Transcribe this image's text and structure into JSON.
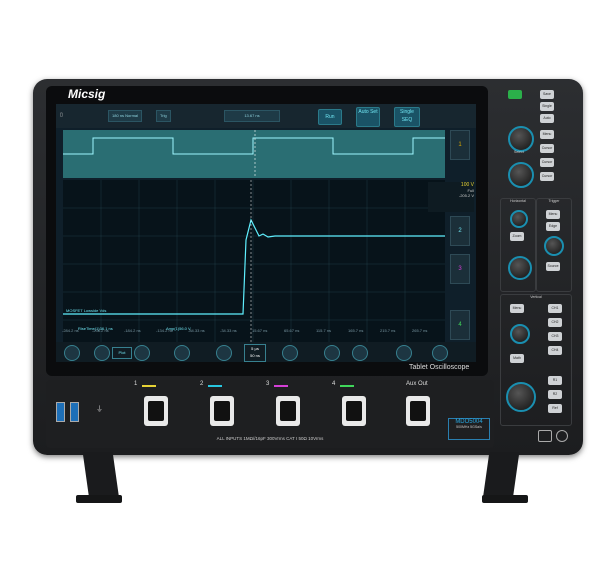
{
  "brand": "Micsig",
  "product_line": "Tablet Oscilloscope",
  "model": "MDO5004",
  "model_spec": "500MHz 5GSa/s",
  "top_bar": {
    "trig_mode": "Normal",
    "trig_label": "Trig",
    "trig_level": "13.67 ns",
    "run_button": "Run",
    "auto_set_button": "Auto Set",
    "single_seq_button": "Single SEQ",
    "timebase": "180 ns"
  },
  "side_buttons": [
    "1",
    "2",
    "3",
    "4"
  ],
  "side_readout": {
    "volts": "100 V",
    "sub1": "Full",
    "sub2": "Off",
    "offset": "-205.2 V"
  },
  "measurements": {
    "rise_time": "RiseTime(1)36.1 ns",
    "amplitude": "Amp(1)56.0 V"
  },
  "trace_label": "MOSFET Lowside Vds",
  "bottom_bar": {
    "time_per_div": "5 µs",
    "time_per_div_sub": "50 ns",
    "mode_label": "Plot"
  },
  "time_ticks": [
    "-284.2 ns",
    "-236.2 ns",
    "-184.2 ns",
    "-134.2 ns",
    "-84.33 ns",
    "-34.33 ns",
    "15.67 ns",
    "65.67 ns",
    "115.7 ns",
    "165.7 ns",
    "215.7 ns",
    "265.7 ns"
  ],
  "right_panel": {
    "top_buttons": [
      "Save",
      "Single",
      "Auto"
    ],
    "menu_buttons": [
      "Menu",
      "Cursor",
      "Cursor",
      "Cursor",
      "Cursor"
    ],
    "select_label": "Select",
    "horizontal_label": "Horizontal",
    "trigger_label": "Trigger",
    "horizontal_buttons": [
      "Menu",
      "Position",
      "Zoom",
      "Scale"
    ],
    "trigger_buttons": [
      "Menu",
      "Edge",
      "Level",
      "Source"
    ],
    "vertical_label": "Vertical",
    "vertical_buttons": [
      "Menu",
      "Position",
      "Math",
      "Scale"
    ],
    "channel_buttons": [
      "CH1",
      "CH2",
      "CH3",
      "CH4"
    ],
    "ref_buttons": [
      "R1",
      "R2",
      "Ref"
    ]
  },
  "front": {
    "channel_labels": [
      "1",
      "2",
      "3",
      "4"
    ],
    "aux_label": "Aux Out",
    "inputs_text": "ALL INPUTS 1MΩ//16pF 300Vrms CAT I    50Ω  10Vrms",
    "channel_colors": [
      "#e6d235",
      "#28c7e0",
      "#d43fd6",
      "#3fd65a"
    ]
  }
}
